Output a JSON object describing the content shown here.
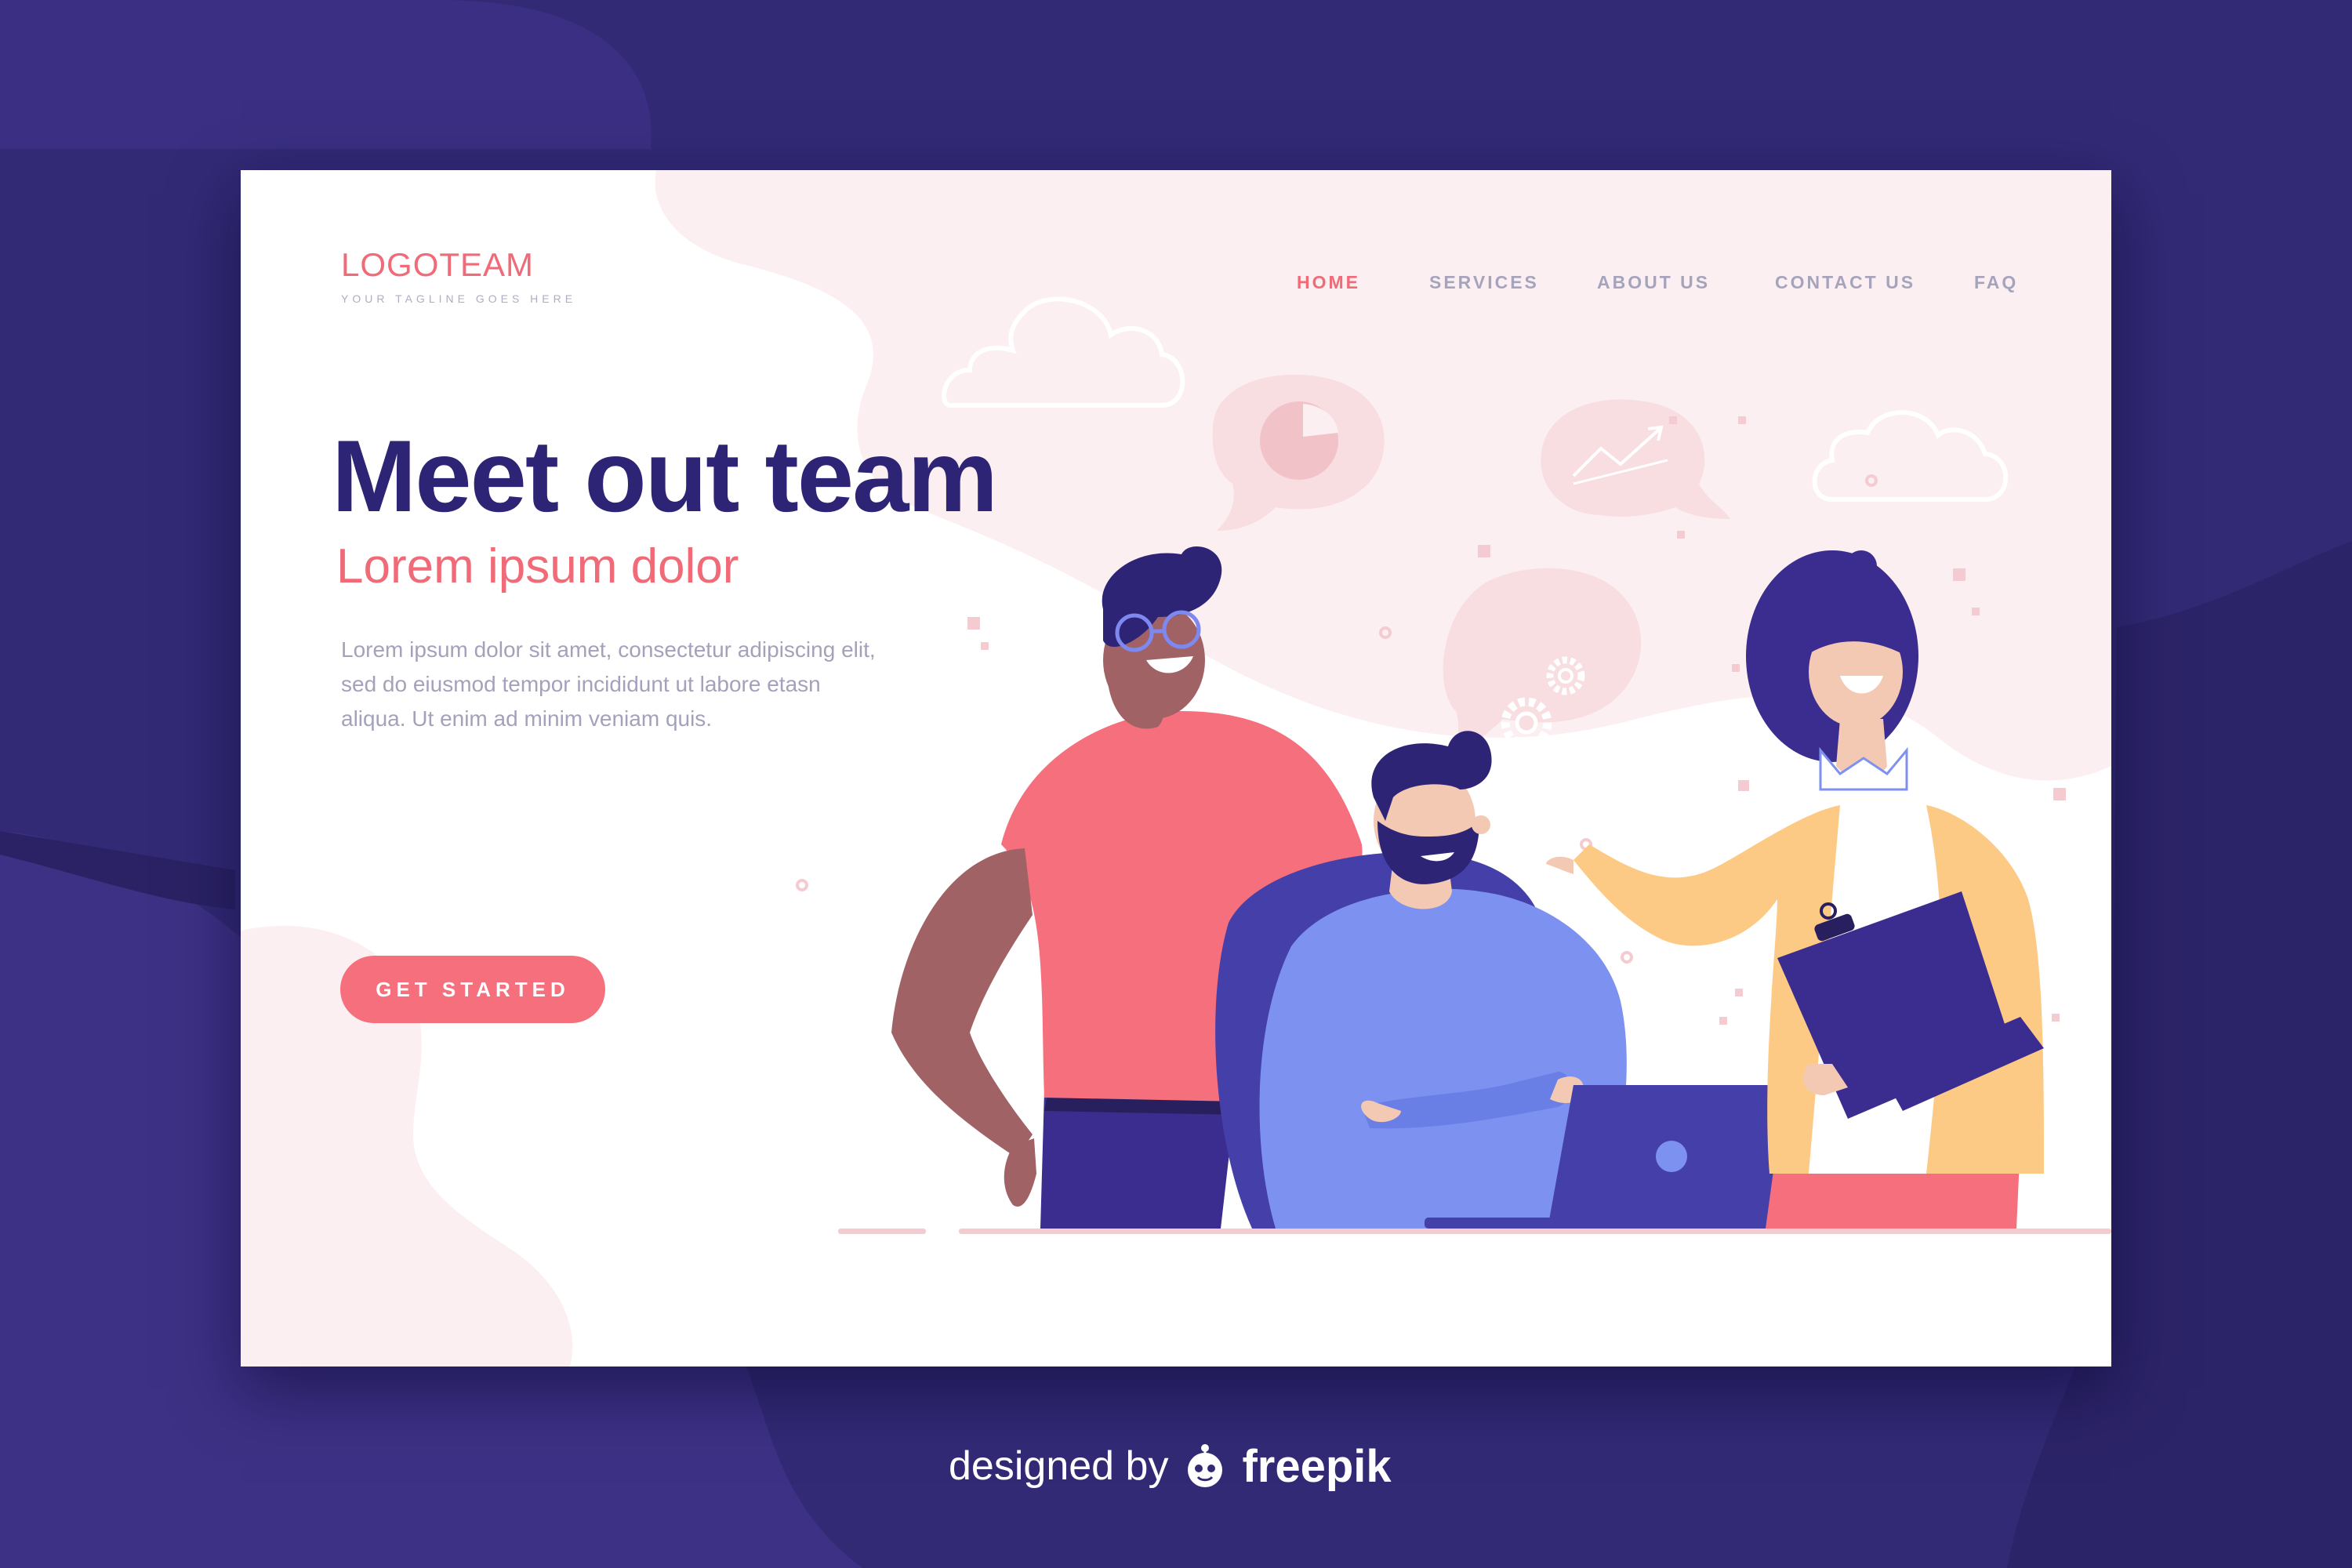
{
  "brand": {
    "logo": "LOGOTEAM",
    "tagline": "YOUR TAGLINE GOES HERE"
  },
  "nav": {
    "items": [
      {
        "label": "HOME",
        "active": true
      },
      {
        "label": "SERVICES",
        "active": false
      },
      {
        "label": "ABOUT US",
        "active": false
      },
      {
        "label": "CONTACT US",
        "active": false
      },
      {
        "label": "FAQ",
        "active": false
      }
    ]
  },
  "hero": {
    "title": "Meet out team",
    "subtitle": "Lorem ipsum dolor",
    "body_lines": [
      "Lorem ipsum dolor sit amet, consectetur adipiscing elit,",
      "sed do eiusmod tempor incididunt ut labore etasn",
      "aliqua. Ut enim ad minim veniam quis."
    ],
    "cta_label": "GET STARTED"
  },
  "illustration": {
    "icons": [
      "cloud-icon",
      "pie-chart-icon",
      "trend-line-icon",
      "gears-icon",
      "laptop-icon",
      "clipboard-icon"
    ]
  },
  "credit": {
    "prefix": "designed by",
    "brand": "freepik",
    "icon": "freepik-logo-icon"
  },
  "colors": {
    "background": "#322a75",
    "accent": "#f06a78",
    "title": "#2e2475",
    "body_text": "#a4a2bb",
    "blush": "#fbeff1"
  }
}
